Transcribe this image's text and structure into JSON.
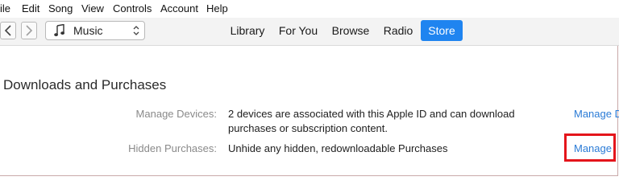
{
  "menu": [
    "ile",
    "Edit",
    "Song",
    "View",
    "Controls",
    "Account",
    "Help"
  ],
  "toolbar": {
    "media_kind": "Music",
    "tabs": [
      "Library",
      "For You",
      "Browse",
      "Radio",
      "Store"
    ],
    "active_tab": "Store",
    "accent": "#1f84f0"
  },
  "content": {
    "title": "Downloads and Purchases",
    "rows": [
      {
        "label": "Manage Devices:",
        "text_line1": "2 devices are associated with this Apple ID and can download",
        "text_line2": "purchases or subscription content.",
        "action": "Manage D"
      },
      {
        "label": "Hidden Purchases:",
        "text_line1": "Unhide any hidden, redownloadable Purchases",
        "action": "Manage"
      }
    ]
  },
  "annotation": {
    "highlight_color": "#e4151b"
  },
  "icons": {
    "back": "chevron-left-icon",
    "forward": "chevron-right-icon",
    "music": "music-note-icon",
    "select": "up-down-arrows-icon"
  }
}
